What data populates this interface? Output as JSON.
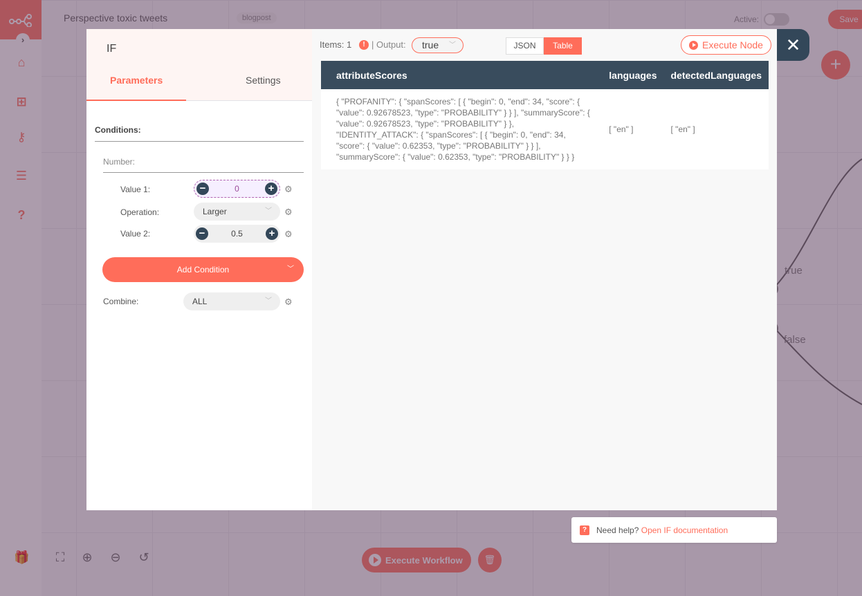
{
  "workflow": {
    "name": "Perspective toxic tweets",
    "tag": "blogpost",
    "active_label": "Active:",
    "active": false,
    "save_label": "Save"
  },
  "sidebar": {
    "items": [
      {
        "icon": "home-icon",
        "glyph": "⌂"
      },
      {
        "icon": "network-icon",
        "glyph": "⊞"
      },
      {
        "icon": "key-icon",
        "glyph": "⚷"
      },
      {
        "icon": "list-check-icon",
        "glyph": "☰"
      },
      {
        "icon": "question-icon",
        "glyph": "?"
      }
    ],
    "collapse_glyph": "›"
  },
  "canvas": {
    "connections": [
      {
        "label": "true"
      },
      {
        "label": "false"
      }
    ],
    "add_node_glyph": "+",
    "controls": {
      "gift_glyph": "🎁",
      "fit_glyph": "⛶",
      "zoom_in_glyph": "⊕",
      "zoom_out_glyph": "⊖",
      "reset_glyph": "↺"
    },
    "execute_workflow_label": "Execute Workflow",
    "trash_glyph": "🗑"
  },
  "node_panel": {
    "title": "IF",
    "tabs": [
      {
        "label": "Parameters",
        "active": true
      },
      {
        "label": "Settings",
        "active": false
      }
    ],
    "conditions_label": "Conditions:",
    "number_label": "Number:",
    "value1": {
      "label": "Value 1:",
      "value": "0"
    },
    "operation": {
      "label": "Operation:",
      "value": "Larger"
    },
    "value2": {
      "label": "Value 2:",
      "value": "0.5"
    },
    "add_condition_label": "Add Condition",
    "combine": {
      "label": "Combine:",
      "value": "ALL"
    },
    "minus_glyph": "−",
    "plus_glyph": "+",
    "gear_glyph": "⚙",
    "chevron_glyph": "﹀"
  },
  "output_panel": {
    "items_label": "Items: 1",
    "info_glyph": "!",
    "output_label": "| Output:",
    "output_value": "true",
    "view_json": "JSON",
    "view_table": "Table",
    "active_view": "Table",
    "execute_node_label": "Execute Node",
    "columns": [
      "attributeScores",
      "languages",
      "detectedLanguages"
    ],
    "rows": [
      [
        "{ \"PROFANITY\": { \"spanScores\": [ { \"begin\": 0, \"end\": 34, \"score\": { \"value\": 0.92678523, \"type\": \"PROBABILITY\" } } ], \"summaryScore\": { \"value\": 0.92678523, \"type\": \"PROBABILITY\" } }, \"IDENTITY_ATTACK\": { \"spanScores\": [ { \"begin\": 0, \"end\": 34, \"score\": { \"value\": 0.62353, \"type\": \"PROBABILITY\" } } ], \"summaryScore\": { \"value\": 0.62353, \"type\": \"PROBABILITY\" } } }",
        "[ \"en\" ]",
        "[ \"en\" ]"
      ]
    ]
  },
  "close_glyph": "✕",
  "help": {
    "icon_glyph": "?",
    "text": "Need help?",
    "link": "Open IF documentation"
  },
  "colors": {
    "accent": "#ff6d5a",
    "dark": "#334759",
    "table_header": "#394c5d"
  }
}
